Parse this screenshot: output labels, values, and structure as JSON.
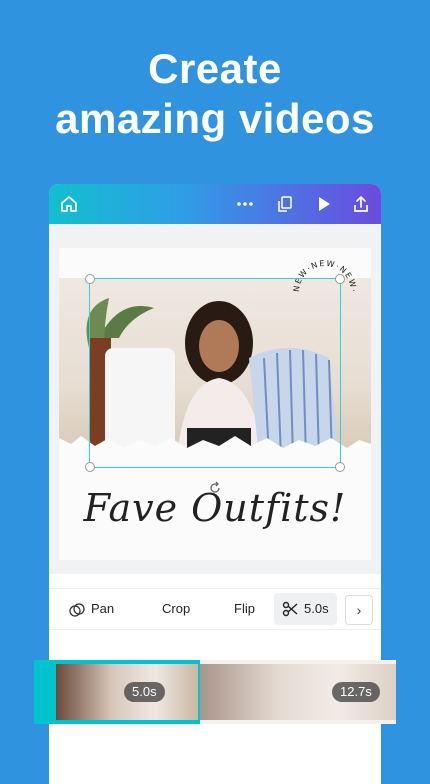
{
  "headline": {
    "line1": "Create",
    "line2": "amazing videos"
  },
  "topbar": {
    "icons": [
      "home-icon",
      "more-icon",
      "pages-icon",
      "play-icon",
      "share-icon"
    ]
  },
  "design": {
    "badge_text": "NEW·NEW·NEW·",
    "script_title": "Fave Outfits!"
  },
  "toolbar": {
    "pan_label": "Pan",
    "crop_label": "Crop",
    "flip_label": "Flip",
    "duration_label": "5.0s",
    "next_label": "›"
  },
  "timeline": {
    "clips": [
      {
        "duration": "5.0s"
      },
      {
        "duration": "12.7s"
      }
    ]
  },
  "colors": {
    "background": "#2f93e0",
    "accent_teal": "#00c4cc",
    "accent_purple": "#6b4be0"
  }
}
